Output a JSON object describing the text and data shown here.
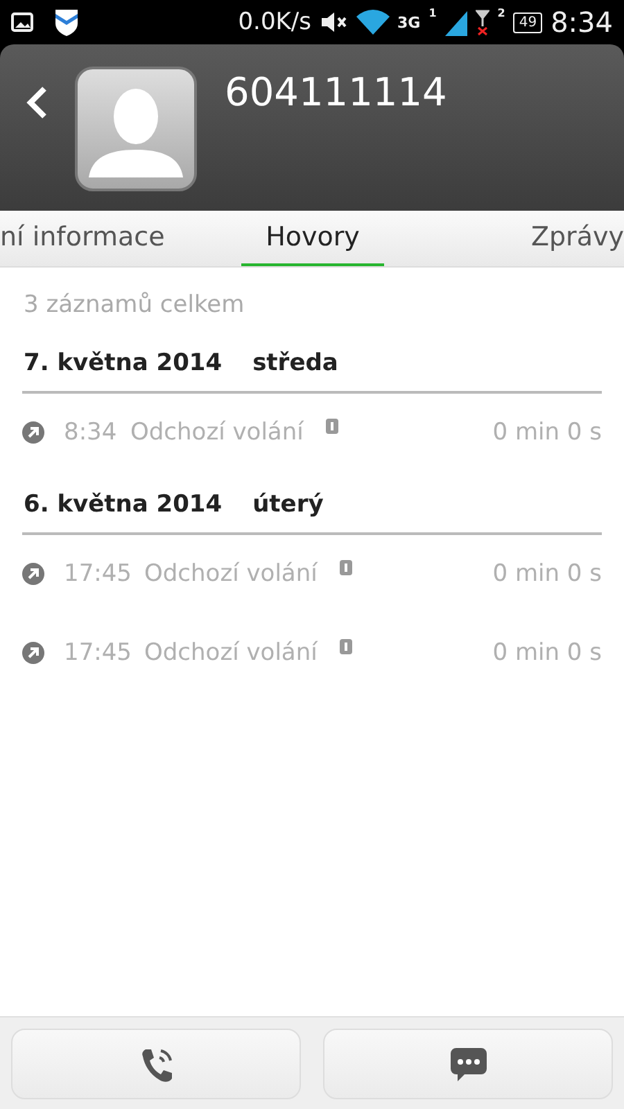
{
  "status_bar": {
    "speed": "0.0K/s",
    "network": "3G",
    "sim1": "1",
    "sim2": "2",
    "battery": "49",
    "time": "8:34"
  },
  "contact": {
    "number": "604111114"
  },
  "tabs": [
    {
      "label": "ní informace",
      "selected": false
    },
    {
      "label": "Hovory",
      "selected": true
    },
    {
      "label": "Zprávy",
      "selected": false
    }
  ],
  "summary": "3 záznamů celkem",
  "groups": [
    {
      "date": "7. května 2014",
      "weekday": "středa",
      "calls": [
        {
          "time": "8:34",
          "type": "Odchozí volání",
          "duration": "0 min 0 s"
        }
      ]
    },
    {
      "date": "6. května 2014",
      "weekday": "úterý",
      "calls": [
        {
          "time": "17:45",
          "type": "Odchozí volání",
          "duration": "0 min 0 s"
        },
        {
          "time": "17:45",
          "type": "Odchozí volání",
          "duration": "0 min 0 s"
        }
      ]
    }
  ]
}
